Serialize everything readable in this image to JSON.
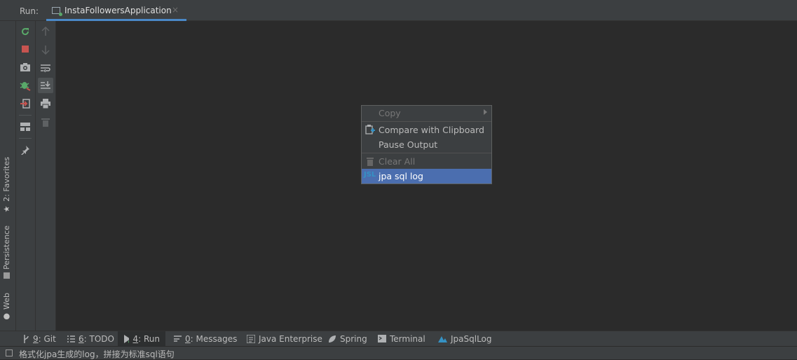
{
  "header": {
    "run_label": "Run:",
    "tab_title": "InstaFollowersApplication",
    "tab_close": "×"
  },
  "side_tabs": [
    {
      "label": "2: Favorites",
      "icon": "star-icon"
    },
    {
      "label": "Persistence",
      "icon": "persistence-icon"
    },
    {
      "label": "Web",
      "icon": "globe-icon"
    }
  ],
  "toolbar_left": [
    "rerun-icon",
    "stop-icon",
    "camera-icon",
    "debug-icon",
    "exit-icon",
    "layout-icon",
    "pin-icon"
  ],
  "toolbar_right": [
    "arrow-up-icon",
    "arrow-down-icon",
    "soft-wrap-icon",
    "scroll-to-end-icon",
    "print-icon",
    "trash-icon"
  ],
  "context_menu": {
    "items": [
      {
        "label": "Copy",
        "disabled": true,
        "submenu": true
      },
      {
        "label": "Compare with Clipboard",
        "disabled": false
      },
      {
        "label": "Pause Output",
        "disabled": false
      },
      {
        "label": "Clear All",
        "disabled": true
      },
      {
        "label": "jpa sql log",
        "disabled": false,
        "highlighted": true,
        "icon_text": "JSL"
      }
    ]
  },
  "bottom_tabs": [
    {
      "prefix": "9",
      "label": ": Git",
      "icon": "git-icon"
    },
    {
      "prefix": "6",
      "label": ": TODO",
      "icon": "todo-icon"
    },
    {
      "prefix": "4",
      "label": ": Run",
      "icon": "run-icon",
      "active": true
    },
    {
      "prefix": "0",
      "label": ": Messages",
      "icon": "messages-icon"
    },
    {
      "prefix": "",
      "label": "Java Enterprise",
      "icon": "java-enterprise-icon"
    },
    {
      "prefix": "",
      "label": "Spring",
      "icon": "spring-icon"
    },
    {
      "prefix": "",
      "label": "Terminal",
      "icon": "terminal-icon"
    },
    {
      "prefix": "",
      "label": "JpaSqlLog",
      "icon": "jpasqllog-icon"
    }
  ],
  "status": {
    "text": "格式化jpa生成的log，拼接为标准sql语句"
  },
  "colors": {
    "accent": "#4a88c7",
    "highlight": "#4b6eaf",
    "run_green": "#59a869",
    "stop_red": "#c75450"
  }
}
